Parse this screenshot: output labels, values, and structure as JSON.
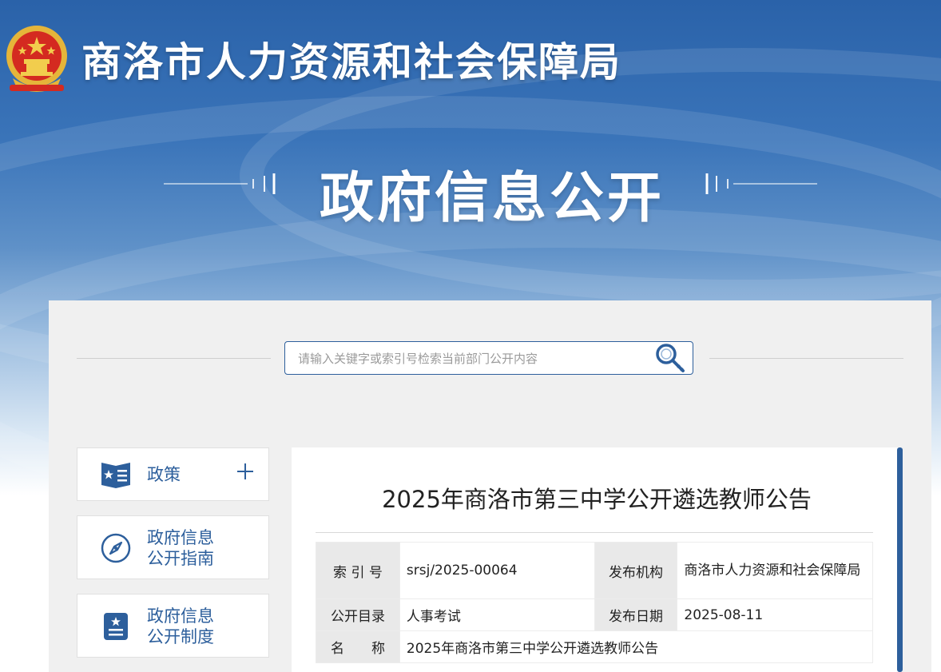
{
  "header": {
    "site_title": "商洛市人力资源和社会保障局",
    "section_title": "政府信息公开"
  },
  "search": {
    "placeholder": "请输入关键字或索引号检索当前部门公开内容"
  },
  "sidebar": {
    "items": [
      {
        "label": "政策",
        "icon": "book-star-icon",
        "expand_icon": "plus-icon"
      },
      {
        "label": "政府信息\n公开指南",
        "icon": "compass-icon"
      },
      {
        "label": "政府信息\n公开制度",
        "icon": "document-star-icon"
      }
    ]
  },
  "article": {
    "title": "2025年商洛市第三中学公开遴选教师公告",
    "meta": {
      "index_label": "索 引 号",
      "index_value": "srsj/2025-00064",
      "publisher_label": "发布机构",
      "publisher_value": "商洛市人力资源和社会保障局",
      "catalog_label": "公开目录",
      "catalog_value": "人事考试",
      "date_label": "发布日期",
      "date_value": "2025-08-11",
      "name_label": "名　　称",
      "name_value": "2025年商洛市第三中学公开遴选教师公告"
    }
  },
  "colors": {
    "brand_blue": "#2d5f9c",
    "banner_blue": "#2a62a9",
    "content_bg": "#f0f0f0"
  }
}
